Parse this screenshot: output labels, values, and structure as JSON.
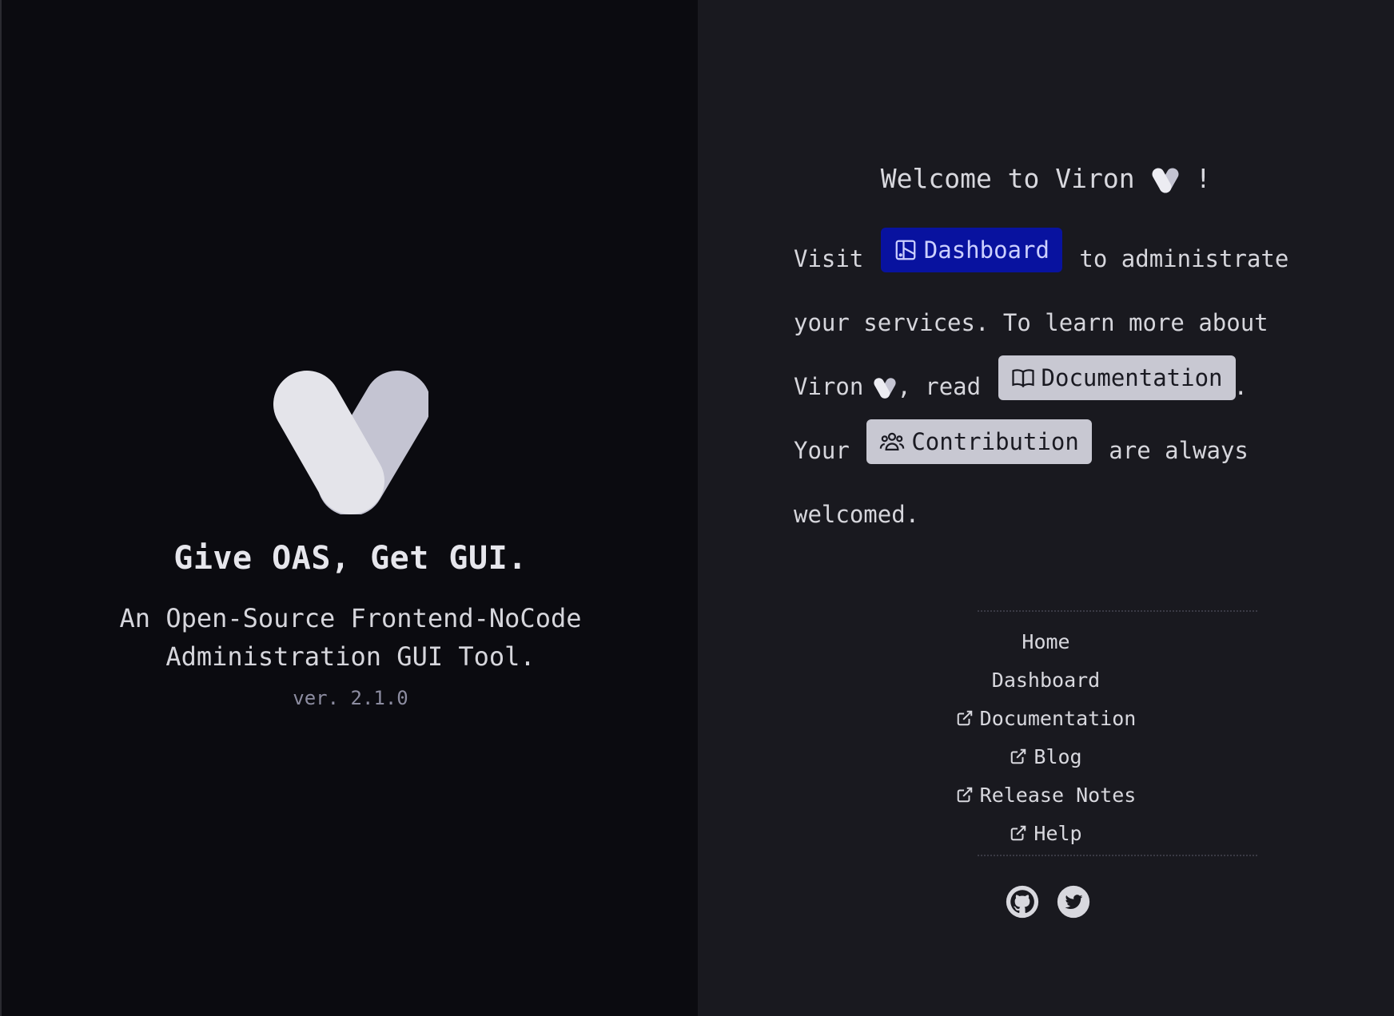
{
  "left": {
    "tagline": "Give OAS, Get GUI.",
    "subtitle_line1": "An Open-Source Frontend-NoCode",
    "subtitle_line2": "Administration GUI Tool.",
    "version": "ver. 2.1.0"
  },
  "right": {
    "welcome_prefix": "Welcome to Viron",
    "welcome_suffix": " !",
    "para": {
      "visit": "Visit",
      "dashboard_chip": "Dashboard",
      "to_admin": "to administrate",
      "your_services": "your services. To learn more about",
      "viron": "Viron",
      "comma_read": ", read",
      "documentation_chip": "Documentation",
      "period": ".",
      "your": "Your",
      "contribution_chip": "Contribution",
      "are_always": "are always",
      "welcomed": "welcomed."
    },
    "nav": [
      {
        "label": "Home",
        "external": false
      },
      {
        "label": "Dashboard",
        "external": false
      },
      {
        "label": "Documentation",
        "external": true
      },
      {
        "label": "Blog",
        "external": true
      },
      {
        "label": "Release Notes",
        "external": true
      },
      {
        "label": "Help",
        "external": true
      }
    ],
    "social": [
      "github-icon",
      "twitter-icon"
    ]
  },
  "colors": {
    "left_bg": "#0b0b10",
    "right_bg": "#19191f",
    "primary_chip": "#08129f",
    "secondary_chip": "#c8c8d2"
  }
}
